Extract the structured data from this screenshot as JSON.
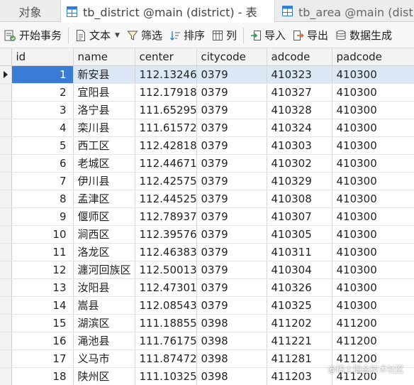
{
  "tabs": [
    {
      "label": "对象"
    },
    {
      "label": "tb_district @main (district) - 表"
    },
    {
      "label": "tb_area @main (district) - 表"
    }
  ],
  "toolbar": {
    "begin_transaction": "开始事务",
    "text": "文本",
    "filter": "筛选",
    "sort": "排序",
    "columns": "列",
    "import": "导入",
    "export": "导出",
    "data_generation": "数据生成"
  },
  "table": {
    "columns": [
      "id",
      "name",
      "center",
      "citycode",
      "adcode",
      "padcode"
    ],
    "selected_row_index": 0,
    "rows": [
      [
        "1",
        "新安县",
        "112.13246",
        "0379",
        "410323",
        "410300"
      ],
      [
        "2",
        "宜阳县",
        "112.17918",
        "0379",
        "410327",
        "410300"
      ],
      [
        "3",
        "洛宁县",
        "111.65295",
        "0379",
        "410328",
        "410300"
      ],
      [
        "4",
        "栾川县",
        "111.61572",
        "0379",
        "410324",
        "410300"
      ],
      [
        "5",
        "西工区",
        "112.42818",
        "0379",
        "410303",
        "410300"
      ],
      [
        "6",
        "老城区",
        "112.44671",
        "0379",
        "410302",
        "410300"
      ],
      [
        "7",
        "伊川县",
        "112.42575",
        "0379",
        "410329",
        "410300"
      ],
      [
        "8",
        "孟津区",
        "112.44525",
        "0379",
        "410308",
        "410300"
      ],
      [
        "9",
        "偃师区",
        "112.78937",
        "0379",
        "410307",
        "410300"
      ],
      [
        "10",
        "涧西区",
        "112.39576",
        "0379",
        "410305",
        "410300"
      ],
      [
        "11",
        "洛龙区",
        "112.46383",
        "0379",
        "410311",
        "410300"
      ],
      [
        "12",
        "瀍河回族区",
        "112.50013",
        "0379",
        "410304",
        "410300"
      ],
      [
        "13",
        "汝阳县",
        "112.47301",
        "0379",
        "410326",
        "410300"
      ],
      [
        "14",
        "嵩县",
        "112.08543",
        "0379",
        "410325",
        "410300"
      ],
      [
        "15",
        "湖滨区",
        "111.18855",
        "0398",
        "411202",
        "411200"
      ],
      [
        "16",
        "渑池县",
        "111.76175",
        "0398",
        "411221",
        "411200"
      ],
      [
        "17",
        "义马市",
        "111.87472",
        "0398",
        "411281",
        "411200"
      ],
      [
        "18",
        "陕州区",
        "111.10325",
        "0398",
        "411203",
        "411200"
      ]
    ]
  },
  "watermark": "@稀土掘金技术社区",
  "colors": {
    "selected_row": "#dce8f6",
    "selected_cell": "#3a7bd5",
    "header_bg": "#f3f3f3"
  }
}
